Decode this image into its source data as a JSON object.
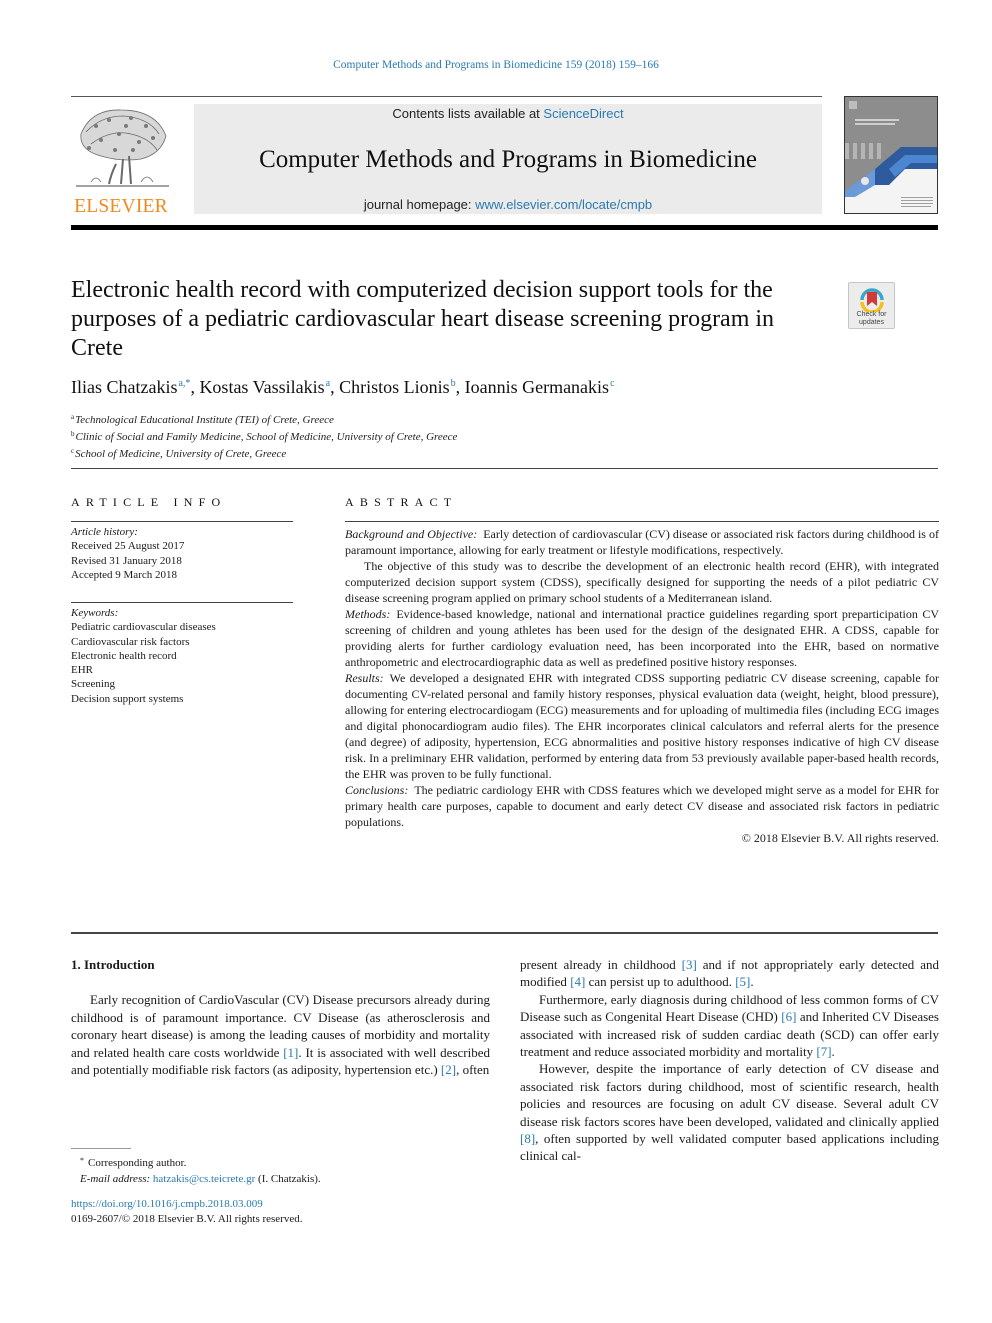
{
  "running_head": "Computer Methods and Programs in Biomedicine 159 (2018) 159–166",
  "header": {
    "publisher_logo_text": "ELSEVIER",
    "contents_prefix": "Contents lists available at ",
    "contents_link": "ScienceDirect",
    "journal_title": "Computer Methods and Programs in Biomedicine",
    "homepage_prefix": "journal homepage: ",
    "homepage_link": "www.elsevier.com/locate/cmpb"
  },
  "crossmark": {
    "line1": "Check for",
    "line2": "updates"
  },
  "article": {
    "title": "Electronic health record with computerized decision support tools for the purposes of a pediatric cardiovascular heart disease screening program in Crete",
    "authors": [
      {
        "name": "Ilias Chatzakis",
        "sup": "a,*",
        "sep": ", "
      },
      {
        "name": "Kostas Vassilakis",
        "sup": "a",
        "sep": ", "
      },
      {
        "name": "Christos Lionis",
        "sup": "b",
        "sep": ", "
      },
      {
        "name": "Ioannis Germanakis",
        "sup": "c",
        "sep": ""
      }
    ],
    "affiliations": [
      {
        "key": "a",
        "text": "Technological Educational Institute (TEI) of Crete, Greece"
      },
      {
        "key": "b",
        "text": "Clinic of Social and Family Medicine, School of Medicine, University of Crete, Greece"
      },
      {
        "key": "c",
        "text": "School of Medicine, University of Crete, Greece"
      }
    ]
  },
  "article_info": {
    "heading": "ARTICLE INFO",
    "history_label": "Article history:",
    "history": [
      "Received 25 August 2017",
      "Revised 31 January 2018",
      "Accepted 9 March 2018"
    ],
    "keywords_label": "Keywords:",
    "keywords": [
      "Pediatric cardiovascular diseases",
      "Cardiovascular risk factors",
      "Electronic health record",
      "EHR",
      "Screening",
      "Decision support systems"
    ]
  },
  "abstract": {
    "heading": "ABSTRACT",
    "background_label": "Background and Objective:",
    "background": "Early detection of cardiovascular (CV) disease or associated risk factors during childhood is of paramount importance, allowing for early treatment or lifestyle modifications, respectively.",
    "objective": "The objective of this study was to describe the development of an electronic health record (EHR), with integrated computerized decision support system (CDSS), specifically designed for supporting the needs of a pilot pediatric CV disease screening program applied on primary school students of a Mediterranean island.",
    "methods_label": "Methods:",
    "methods": "Evidence-based knowledge, national and international practice guidelines regarding sport preparticipation CV screening of children and young athletes has been used for the design of the designated EHR. A CDSS, capable for providing alerts for further cardiology evaluation need, has been incorporated into the EHR, based on normative anthropometric and electrocardiographic data as well as predefined positive history responses.",
    "results_label": "Results:",
    "results": "We developed a designated EHR with integrated CDSS supporting pediatric CV disease screening, capable for documenting CV-related personal and family history responses, physical evaluation data (weight, height, blood pressure), allowing for entering electrocardiogam (ECG) measurements and for uploading of multimedia files (including ECG images and digital phonocardiogram audio files). The EHR incorporates clinical calculators and referral alerts for the presence (and degree) of adiposity, hypertension, ECG abnormalities and positive history responses indicative of high CV disease risk. In a preliminary EHR validation, performed by entering data from 53 previously available paper-based health records, the EHR was proven to be fully functional.",
    "conclusions_label": "Conclusions:",
    "conclusions": "The pediatric cardiology EHR with CDSS features which we developed might serve as a model for EHR for primary health care purposes, capable to document and early detect CV disease and associated risk factors in pediatric populations.",
    "copyright": "© 2018 Elsevier B.V. All rights reserved."
  },
  "body": {
    "section_heading": "1. Introduction",
    "left_p1_a": "Early recognition of CardioVascular (CV) Disease precursors already during childhood is of paramount importance. CV Disease (as atherosclerosis and coronary heart disease) is among the leading causes of morbidity and mortality and related health care costs worldwide ",
    "ref1": "[1]",
    "left_p1_b": ". It is associated with well described and potentially modifiable risk factors (as adiposity, hypertension etc.) ",
    "ref2": "[2]",
    "left_p1_c": ", often",
    "right_p1_a": "present already in childhood ",
    "ref3": "[3]",
    "right_p1_b": " and if not appropriately early detected and modified ",
    "ref4": "[4]",
    "right_p1_c": " can persist up to adulthood. ",
    "ref5": "[5]",
    "right_p1_d": ".",
    "right_p2_a": "Furthermore, early diagnosis during childhood of less common forms of CV Disease such as Congenital Heart Disease (CHD) ",
    "ref6": "[6]",
    "right_p2_b": " and Inherited CV Diseases associated with increased risk of sudden cardiac death (SCD) can offer early treatment and reduce associated morbidity and mortality ",
    "ref7": "[7]",
    "right_p2_c": ".",
    "right_p3_a": "However, despite the importance of early detection of CV disease and associated risk factors during childhood, most of scientific research, health policies and resources are focusing on adult CV disease. Several adult CV disease risk factors scores have been developed, validated and clinically applied ",
    "ref8": "[8]",
    "right_p3_b": ", often supported by well validated computer based applications including clinical cal-"
  },
  "footnotes": {
    "corresponding_mark": "*",
    "corresponding": "Corresponding author.",
    "email_label": "E-mail address:",
    "email": "hatzakis@cs.teicrete.gr",
    "email_suffix": " (I. Chatzakis).",
    "doi": "https://doi.org/10.1016/j.cmpb.2018.03.009",
    "issn_line": "0169-2607/© 2018 Elsevier B.V. All rights reserved."
  },
  "colors": {
    "link": "#2a7ab0",
    "elsevier_orange": "#f08a1d",
    "masthead_bg": "#ebebeb"
  }
}
